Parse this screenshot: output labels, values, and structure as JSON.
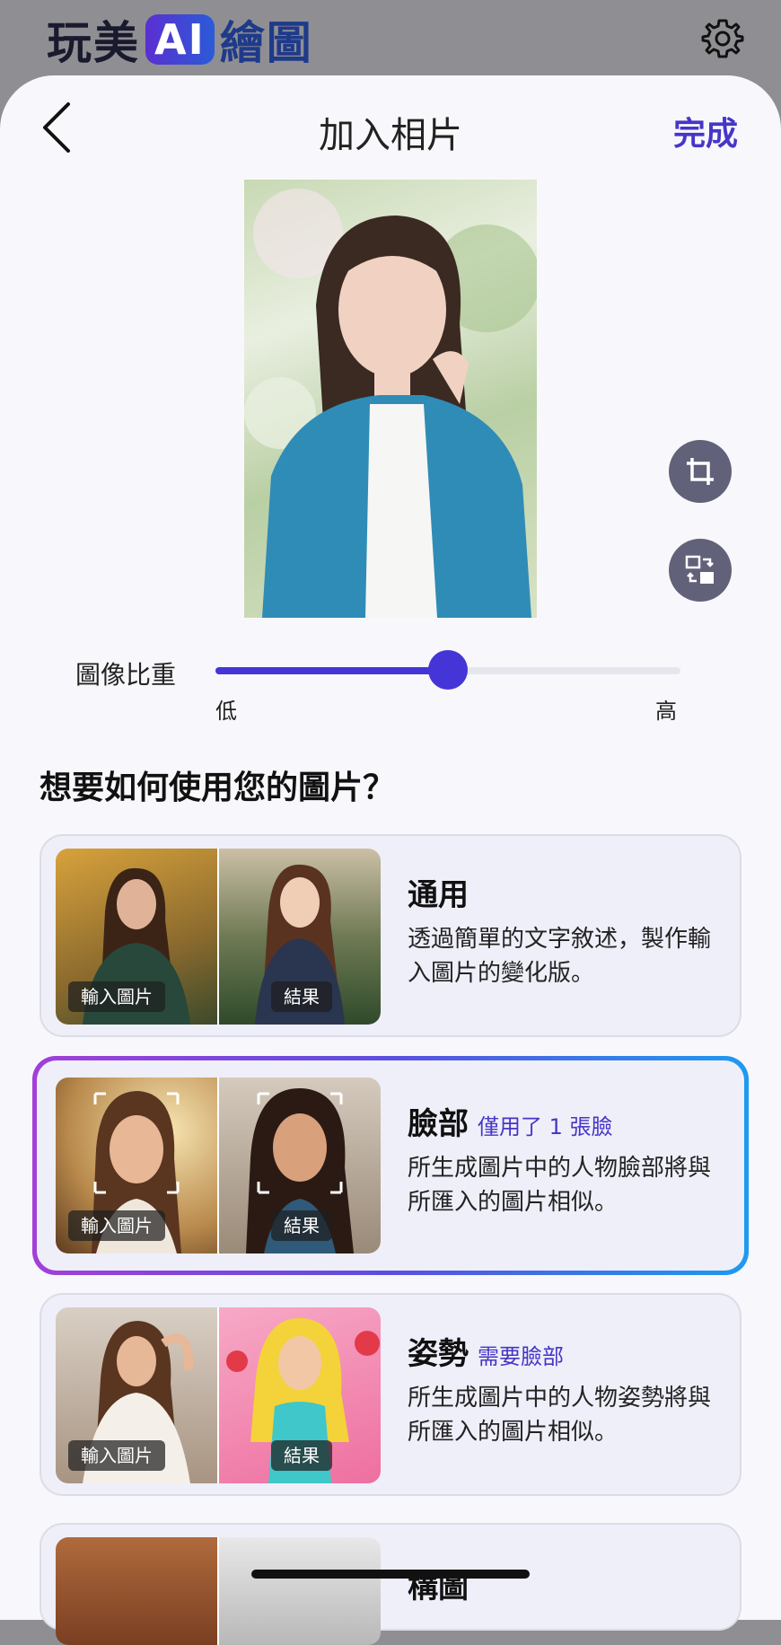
{
  "app": {
    "logo_prefix": "玩美",
    "logo_ai": "AI",
    "logo_suffix": "繪圖"
  },
  "header": {
    "title": "加入相片",
    "done_label": "完成"
  },
  "slider": {
    "label": "圖像比重",
    "low_label": "低",
    "high_label": "高",
    "value": 0.5
  },
  "question": "想要如何使用您的圖片？",
  "options": [
    {
      "title": "通用",
      "subtitle": "",
      "description": "透過簡單的文字敘述，製作輸入圖片的變化版。",
      "input_tag": "輸入圖片",
      "result_tag": "結果",
      "selected": false
    },
    {
      "title": "臉部",
      "subtitle": "僅用了 1 張臉",
      "description": "所生成圖片中的人物臉部將與所匯入的圖片相似。",
      "input_tag": "輸入圖片",
      "result_tag": "結果",
      "selected": true
    },
    {
      "title": "姿勢",
      "subtitle": "需要臉部",
      "description": "所生成圖片中的人物姿勢將與所匯入的圖片相似。",
      "input_tag": "輸入圖片",
      "result_tag": "結果",
      "selected": false
    },
    {
      "title": "構圖",
      "subtitle": "",
      "description": "",
      "input_tag": "",
      "result_tag": "",
      "selected": false
    }
  ],
  "colors": {
    "accent": "#4636c8",
    "slider": "#4535d6",
    "card_bg": "#efeff9"
  },
  "icons": {
    "settings": "gear-icon",
    "back": "chevron-left-icon",
    "crop": "crop-icon",
    "swap": "swap-image-icon"
  }
}
